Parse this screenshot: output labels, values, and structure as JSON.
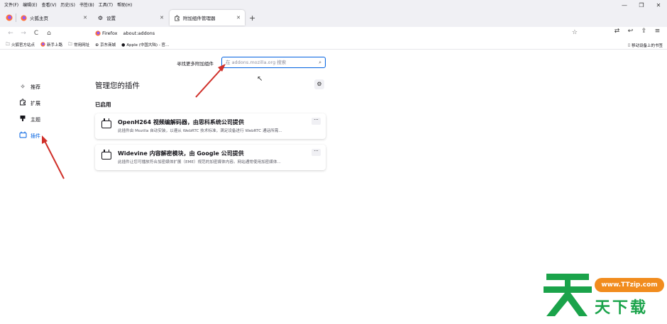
{
  "menubar": {
    "items": [
      "文件(F)",
      "编辑(E)",
      "查看(V)",
      "历史(S)",
      "书签(B)",
      "工具(T)",
      "帮助(H)"
    ]
  },
  "window_controls": [
    "—",
    "❐",
    "✕"
  ],
  "tabs": [
    {
      "label": "火狐主页",
      "icon": "firefox-icon",
      "close": "✕",
      "active": false
    },
    {
      "label": "设置",
      "icon": "gear-icon",
      "close": "✕",
      "active": false
    },
    {
      "label": "附加组件管理器",
      "icon": "puzzle-icon",
      "close": "✕",
      "active": true
    }
  ],
  "newtab_label": "+",
  "toolbar": {
    "back": "←",
    "forward": "→",
    "reload": "C",
    "home": "⌂",
    "identity_label": "Firefox",
    "url": "about:addons",
    "star": "☆",
    "right_icons": [
      "⇄",
      "↩",
      "⇪",
      "≡"
    ]
  },
  "bookmarks": {
    "items": [
      {
        "label": "火狐官方站点",
        "icon": "folder-icon"
      },
      {
        "label": "新手上路",
        "icon": "firefox-icon"
      },
      {
        "label": "常用网址",
        "icon": "folder-icon"
      },
      {
        "label": "京东商城",
        "icon": "globe-icon"
      },
      {
        "label": "Apple (中国大陆) - 官...",
        "icon": "apple-icon"
      }
    ],
    "mobile_label": "移动设备上的书签"
  },
  "addons_page": {
    "find_more_label": "寻找更多附加组件",
    "search_placeholder": "在 addons.mozilla.org 搜索",
    "sidebar": [
      {
        "label": "推荐",
        "icon": "sparkle-icon",
        "active": false
      },
      {
        "label": "扩展",
        "icon": "puzzle-icon",
        "active": false
      },
      {
        "label": "主题",
        "icon": "brush-icon",
        "active": false
      },
      {
        "label": "插件",
        "icon": "plugin-icon",
        "active": true
      }
    ],
    "main_title": "管理您的插件",
    "gear": "⚙",
    "section_enabled": "已启用",
    "plugins": [
      {
        "name": "OpenH264 视频编解码器，由思科系统公司提供",
        "description": "此插件由 Mozilla 自动安装，以遵从 WebRTC 技术标准，满足设备进行 WebRTC 通话所需...",
        "more": "···"
      },
      {
        "name": "Widevine 内容解密模块，由 Google 公司提供",
        "description": "此插件让您可播放符合加密媒体扩展（EME）规范的加密媒体内容。网站通常使用加密媒体...",
        "more": "···"
      }
    ]
  },
  "watermark": {
    "url": "www.TTzip.com",
    "text": "天下载",
    "colors": {
      "green": "#1aa34a",
      "orange": "#f18c1e"
    }
  },
  "colors": {
    "accent": "#0061e0",
    "annotation_arrow": "#d0302a"
  }
}
